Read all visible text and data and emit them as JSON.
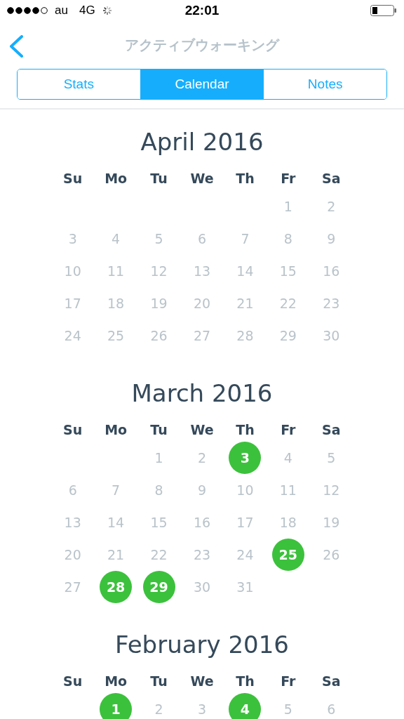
{
  "status_bar": {
    "carrier": "au",
    "network": "4G",
    "time": "22:01"
  },
  "nav": {
    "title": "アクティブウォーキング"
  },
  "tabs": [
    {
      "label": "Stats",
      "selected": false
    },
    {
      "label": "Calendar",
      "selected": true
    },
    {
      "label": "Notes",
      "selected": false
    }
  ],
  "months": [
    {
      "title": "April 2016",
      "weekdays": [
        "Su",
        "Mo",
        "Tu",
        "We",
        "Th",
        "Fr",
        "Sa"
      ],
      "weeks": [
        [
          {
            "kind": "blank"
          },
          {
            "kind": "blank"
          },
          {
            "kind": "blank"
          },
          {
            "kind": "blank"
          },
          {
            "kind": "blank"
          },
          {
            "kind": "day",
            "day": "1",
            "marked": false
          },
          {
            "kind": "day",
            "day": "2",
            "marked": false
          }
        ],
        [
          {
            "kind": "day",
            "day": "3",
            "marked": false
          },
          {
            "kind": "day",
            "day": "4",
            "marked": false
          },
          {
            "kind": "day",
            "day": "5",
            "marked": false
          },
          {
            "kind": "day",
            "day": "6",
            "marked": false
          },
          {
            "kind": "day",
            "day": "7",
            "marked": false
          },
          {
            "kind": "day",
            "day": "8",
            "marked": false
          },
          {
            "kind": "day",
            "day": "9",
            "marked": false
          }
        ],
        [
          {
            "kind": "day",
            "day": "10",
            "marked": false
          },
          {
            "kind": "day",
            "day": "11",
            "marked": false
          },
          {
            "kind": "day",
            "day": "12",
            "marked": false
          },
          {
            "kind": "day",
            "day": "13",
            "marked": false
          },
          {
            "kind": "day",
            "day": "14",
            "marked": false
          },
          {
            "kind": "day",
            "day": "15",
            "marked": false
          },
          {
            "kind": "day",
            "day": "16",
            "marked": false
          }
        ],
        [
          {
            "kind": "day",
            "day": "17",
            "marked": false
          },
          {
            "kind": "day",
            "day": "18",
            "marked": false
          },
          {
            "kind": "day",
            "day": "19",
            "marked": false
          },
          {
            "kind": "day",
            "day": "20",
            "marked": false
          },
          {
            "kind": "day",
            "day": "21",
            "marked": false
          },
          {
            "kind": "day",
            "day": "22",
            "marked": false
          },
          {
            "kind": "day",
            "day": "23",
            "marked": false
          }
        ],
        [
          {
            "kind": "day",
            "day": "24",
            "marked": false
          },
          {
            "kind": "day",
            "day": "25",
            "marked": false
          },
          {
            "kind": "day",
            "day": "26",
            "marked": false
          },
          {
            "kind": "day",
            "day": "27",
            "marked": false
          },
          {
            "kind": "day",
            "day": "28",
            "marked": false
          },
          {
            "kind": "day",
            "day": "29",
            "marked": false
          },
          {
            "kind": "day",
            "day": "30",
            "marked": false
          }
        ]
      ]
    },
    {
      "title": "March 2016",
      "weekdays": [
        "Su",
        "Mo",
        "Tu",
        "We",
        "Th",
        "Fr",
        "Sa"
      ],
      "weeks": [
        [
          {
            "kind": "blank"
          },
          {
            "kind": "blank"
          },
          {
            "kind": "day",
            "day": "1",
            "marked": false
          },
          {
            "kind": "day",
            "day": "2",
            "marked": false
          },
          {
            "kind": "day",
            "day": "3",
            "marked": true
          },
          {
            "kind": "day",
            "day": "4",
            "marked": false
          },
          {
            "kind": "day",
            "day": "5",
            "marked": false
          }
        ],
        [
          {
            "kind": "day",
            "day": "6",
            "marked": false
          },
          {
            "kind": "day",
            "day": "7",
            "marked": false
          },
          {
            "kind": "day",
            "day": "8",
            "marked": false
          },
          {
            "kind": "day",
            "day": "9",
            "marked": false
          },
          {
            "kind": "day",
            "day": "10",
            "marked": false
          },
          {
            "kind": "day",
            "day": "11",
            "marked": false
          },
          {
            "kind": "day",
            "day": "12",
            "marked": false
          }
        ],
        [
          {
            "kind": "day",
            "day": "13",
            "marked": false
          },
          {
            "kind": "day",
            "day": "14",
            "marked": false
          },
          {
            "kind": "day",
            "day": "15",
            "marked": false
          },
          {
            "kind": "day",
            "day": "16",
            "marked": false
          },
          {
            "kind": "day",
            "day": "17",
            "marked": false
          },
          {
            "kind": "day",
            "day": "18",
            "marked": false
          },
          {
            "kind": "day",
            "day": "19",
            "marked": false
          }
        ],
        [
          {
            "kind": "day",
            "day": "20",
            "marked": false
          },
          {
            "kind": "day",
            "day": "21",
            "marked": false
          },
          {
            "kind": "day",
            "day": "22",
            "marked": false
          },
          {
            "kind": "day",
            "day": "23",
            "marked": false
          },
          {
            "kind": "day",
            "day": "24",
            "marked": false
          },
          {
            "kind": "day",
            "day": "25",
            "marked": true
          },
          {
            "kind": "day",
            "day": "26",
            "marked": false
          }
        ],
        [
          {
            "kind": "day",
            "day": "27",
            "marked": false
          },
          {
            "kind": "day",
            "day": "28",
            "marked": true
          },
          {
            "kind": "day",
            "day": "29",
            "marked": true
          },
          {
            "kind": "day",
            "day": "30",
            "marked": false
          },
          {
            "kind": "day",
            "day": "31",
            "marked": false
          }
        ]
      ]
    },
    {
      "title": "February 2016",
      "weekdays": [
        "Su",
        "Mo",
        "Tu",
        "We",
        "Th",
        "Fr",
        "Sa"
      ],
      "weeks": [
        [
          {
            "kind": "blank"
          },
          {
            "kind": "day",
            "day": "1",
            "marked": true
          },
          {
            "kind": "day",
            "day": "2",
            "marked": false
          },
          {
            "kind": "day",
            "day": "3",
            "marked": false
          },
          {
            "kind": "day",
            "day": "4",
            "marked": true
          },
          {
            "kind": "day",
            "day": "5",
            "marked": false
          },
          {
            "kind": "day",
            "day": "6",
            "marked": false
          }
        ]
      ]
    }
  ]
}
